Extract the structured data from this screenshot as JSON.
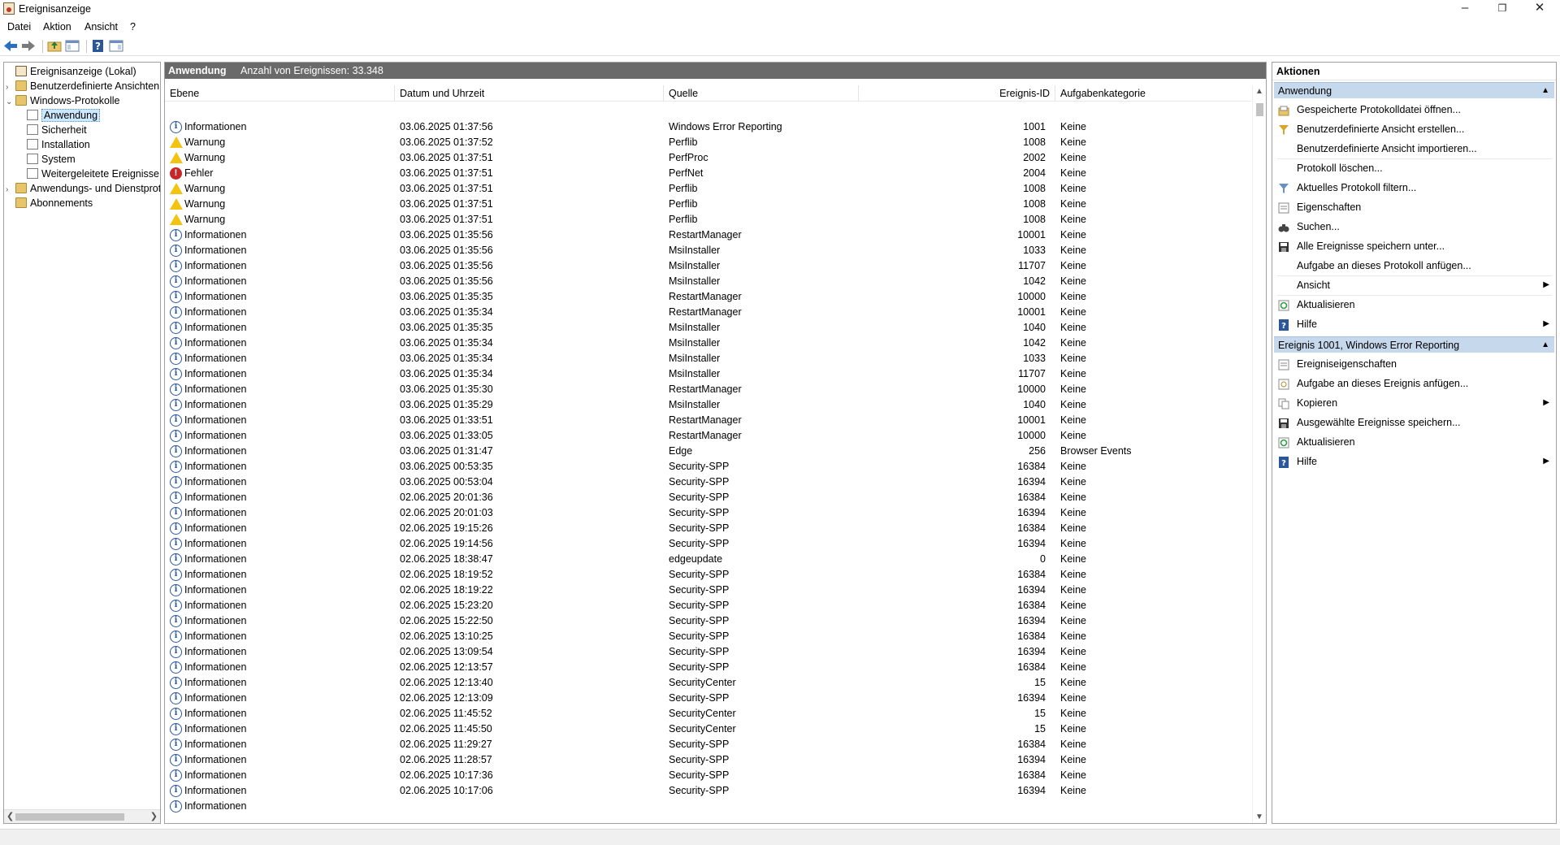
{
  "window": {
    "title": "Ereignisanzeige"
  },
  "menu": [
    "Datei",
    "Aktion",
    "Ansicht",
    "?"
  ],
  "tree": {
    "items": [
      {
        "label": "Ereignisanzeige (Lokal)",
        "level": 0,
        "icon": "root-icon",
        "expander": ""
      },
      {
        "label": "Benutzerdefinierte Ansichten",
        "level": 1,
        "icon": "folder-icon",
        "expander": "›"
      },
      {
        "label": "Windows-Protokolle",
        "level": 1,
        "icon": "folder-icon",
        "expander": "⌄"
      },
      {
        "label": "Anwendung",
        "level": 2,
        "icon": "log-icon",
        "expander": "",
        "selected": true
      },
      {
        "label": "Sicherheit",
        "level": 2,
        "icon": "log-icon",
        "expander": ""
      },
      {
        "label": "Installation",
        "level": 2,
        "icon": "log-icon",
        "expander": ""
      },
      {
        "label": "System",
        "level": 2,
        "icon": "log-icon",
        "expander": ""
      },
      {
        "label": "Weitergeleitete Ereignisse",
        "level": 2,
        "icon": "log-icon",
        "expander": ""
      },
      {
        "label": "Anwendungs- und Dienstprotokolle",
        "level": 1,
        "icon": "folder-icon",
        "expander": "›"
      },
      {
        "label": "Abonnements",
        "level": 1,
        "icon": "folder-icon",
        "expander": ""
      }
    ]
  },
  "center": {
    "log_name": "Anwendung",
    "count_text": "Anzahl von Ereignissen: 33.348",
    "columns": [
      "Ebene",
      "Datum und Uhrzeit",
      "Quelle",
      "Ereignis-ID",
      "Aufgabenkategorie"
    ],
    "rows": [
      {
        "level": "Informationen",
        "type": "info",
        "date": "03.06.2025 01:37:56",
        "source": "Windows Error Reporting",
        "id": "1001",
        "cat": "Keine"
      },
      {
        "level": "Warnung",
        "type": "warn",
        "date": "03.06.2025 01:37:52",
        "source": "Perflib",
        "id": "1008",
        "cat": "Keine"
      },
      {
        "level": "Warnung",
        "type": "warn",
        "date": "03.06.2025 01:37:51",
        "source": "PerfProc",
        "id": "2002",
        "cat": "Keine"
      },
      {
        "level": "Fehler",
        "type": "error",
        "date": "03.06.2025 01:37:51",
        "source": "PerfNet",
        "id": "2004",
        "cat": "Keine"
      },
      {
        "level": "Warnung",
        "type": "warn",
        "date": "03.06.2025 01:37:51",
        "source": "Perflib",
        "id": "1008",
        "cat": "Keine"
      },
      {
        "level": "Warnung",
        "type": "warn",
        "date": "03.06.2025 01:37:51",
        "source": "Perflib",
        "id": "1008",
        "cat": "Keine"
      },
      {
        "level": "Warnung",
        "type": "warn",
        "date": "03.06.2025 01:37:51",
        "source": "Perflib",
        "id": "1008",
        "cat": "Keine"
      },
      {
        "level": "Informationen",
        "type": "info",
        "date": "03.06.2025 01:35:56",
        "source": "RestartManager",
        "id": "10001",
        "cat": "Keine"
      },
      {
        "level": "Informationen",
        "type": "info",
        "date": "03.06.2025 01:35:56",
        "source": "MsiInstaller",
        "id": "1033",
        "cat": "Keine"
      },
      {
        "level": "Informationen",
        "type": "info",
        "date": "03.06.2025 01:35:56",
        "source": "MsiInstaller",
        "id": "11707",
        "cat": "Keine"
      },
      {
        "level": "Informationen",
        "type": "info",
        "date": "03.06.2025 01:35:56",
        "source": "MsiInstaller",
        "id": "1042",
        "cat": "Keine"
      },
      {
        "level": "Informationen",
        "type": "info",
        "date": "03.06.2025 01:35:35",
        "source": "RestartManager",
        "id": "10000",
        "cat": "Keine"
      },
      {
        "level": "Informationen",
        "type": "info",
        "date": "03.06.2025 01:35:34",
        "source": "RestartManager",
        "id": "10001",
        "cat": "Keine"
      },
      {
        "level": "Informationen",
        "type": "info",
        "date": "03.06.2025 01:35:35",
        "source": "MsiInstaller",
        "id": "1040",
        "cat": "Keine"
      },
      {
        "level": "Informationen",
        "type": "info",
        "date": "03.06.2025 01:35:34",
        "source": "MsiInstaller",
        "id": "1042",
        "cat": "Keine"
      },
      {
        "level": "Informationen",
        "type": "info",
        "date": "03.06.2025 01:35:34",
        "source": "MsiInstaller",
        "id": "1033",
        "cat": "Keine"
      },
      {
        "level": "Informationen",
        "type": "info",
        "date": "03.06.2025 01:35:34",
        "source": "MsiInstaller",
        "id": "11707",
        "cat": "Keine"
      },
      {
        "level": "Informationen",
        "type": "info",
        "date": "03.06.2025 01:35:30",
        "source": "RestartManager",
        "id": "10000",
        "cat": "Keine"
      },
      {
        "level": "Informationen",
        "type": "info",
        "date": "03.06.2025 01:35:29",
        "source": "MsiInstaller",
        "id": "1040",
        "cat": "Keine"
      },
      {
        "level": "Informationen",
        "type": "info",
        "date": "03.06.2025 01:33:51",
        "source": "RestartManager",
        "id": "10001",
        "cat": "Keine"
      },
      {
        "level": "Informationen",
        "type": "info",
        "date": "03.06.2025 01:33:05",
        "source": "RestartManager",
        "id": "10000",
        "cat": "Keine"
      },
      {
        "level": "Informationen",
        "type": "info",
        "date": "03.06.2025 01:31:47",
        "source": "Edge",
        "id": "256",
        "cat": "Browser Events"
      },
      {
        "level": "Informationen",
        "type": "info",
        "date": "03.06.2025 00:53:35",
        "source": "Security-SPP",
        "id": "16384",
        "cat": "Keine"
      },
      {
        "level": "Informationen",
        "type": "info",
        "date": "03.06.2025 00:53:04",
        "source": "Security-SPP",
        "id": "16394",
        "cat": "Keine"
      },
      {
        "level": "Informationen",
        "type": "info",
        "date": "02.06.2025 20:01:36",
        "source": "Security-SPP",
        "id": "16384",
        "cat": "Keine"
      },
      {
        "level": "Informationen",
        "type": "info",
        "date": "02.06.2025 20:01:03",
        "source": "Security-SPP",
        "id": "16394",
        "cat": "Keine"
      },
      {
        "level": "Informationen",
        "type": "info",
        "date": "02.06.2025 19:15:26",
        "source": "Security-SPP",
        "id": "16384",
        "cat": "Keine"
      },
      {
        "level": "Informationen",
        "type": "info",
        "date": "02.06.2025 19:14:56",
        "source": "Security-SPP",
        "id": "16394",
        "cat": "Keine"
      },
      {
        "level": "Informationen",
        "type": "info",
        "date": "02.06.2025 18:38:47",
        "source": "edgeupdate",
        "id": "0",
        "cat": "Keine"
      },
      {
        "level": "Informationen",
        "type": "info",
        "date": "02.06.2025 18:19:52",
        "source": "Security-SPP",
        "id": "16384",
        "cat": "Keine"
      },
      {
        "level": "Informationen",
        "type": "info",
        "date": "02.06.2025 18:19:22",
        "source": "Security-SPP",
        "id": "16394",
        "cat": "Keine"
      },
      {
        "level": "Informationen",
        "type": "info",
        "date": "02.06.2025 15:23:20",
        "source": "Security-SPP",
        "id": "16384",
        "cat": "Keine"
      },
      {
        "level": "Informationen",
        "type": "info",
        "date": "02.06.2025 15:22:50",
        "source": "Security-SPP",
        "id": "16394",
        "cat": "Keine"
      },
      {
        "level": "Informationen",
        "type": "info",
        "date": "02.06.2025 13:10:25",
        "source": "Security-SPP",
        "id": "16384",
        "cat": "Keine"
      },
      {
        "level": "Informationen",
        "type": "info",
        "date": "02.06.2025 13:09:54",
        "source": "Security-SPP",
        "id": "16394",
        "cat": "Keine"
      },
      {
        "level": "Informationen",
        "type": "info",
        "date": "02.06.2025 12:13:57",
        "source": "Security-SPP",
        "id": "16384",
        "cat": "Keine"
      },
      {
        "level": "Informationen",
        "type": "info",
        "date": "02.06.2025 12:13:40",
        "source": "SecurityCenter",
        "id": "15",
        "cat": "Keine"
      },
      {
        "level": "Informationen",
        "type": "info",
        "date": "02.06.2025 12:13:09",
        "source": "Security-SPP",
        "id": "16394",
        "cat": "Keine"
      },
      {
        "level": "Informationen",
        "type": "info",
        "date": "02.06.2025 11:45:52",
        "source": "SecurityCenter",
        "id": "15",
        "cat": "Keine"
      },
      {
        "level": "Informationen",
        "type": "info",
        "date": "02.06.2025 11:45:50",
        "source": "SecurityCenter",
        "id": "15",
        "cat": "Keine"
      },
      {
        "level": "Informationen",
        "type": "info",
        "date": "02.06.2025 11:29:27",
        "source": "Security-SPP",
        "id": "16384",
        "cat": "Keine"
      },
      {
        "level": "Informationen",
        "type": "info",
        "date": "02.06.2025 11:28:57",
        "source": "Security-SPP",
        "id": "16394",
        "cat": "Keine"
      },
      {
        "level": "Informationen",
        "type": "info",
        "date": "02.06.2025 10:17:36",
        "source": "Security-SPP",
        "id": "16384",
        "cat": "Keine"
      },
      {
        "level": "Informationen",
        "type": "info",
        "date": "02.06.2025 10:17:06",
        "source": "Security-SPP",
        "id": "16394",
        "cat": "Keine"
      },
      {
        "level": "Informationen",
        "type": "info",
        "date": "",
        "source": "",
        "id": "",
        "cat": ""
      }
    ]
  },
  "actions": {
    "title": "Aktionen",
    "sections": [
      {
        "title": "Anwendung",
        "items": [
          {
            "label": "Gespeicherte Protokolldatei öffnen...",
            "icon": "open-log-icon"
          },
          {
            "label": "Benutzerdefinierte Ansicht erstellen...",
            "icon": "filter-create-icon"
          },
          {
            "label": "Benutzerdefinierte Ansicht importieren...",
            "icon": ""
          },
          {
            "label": "Protokoll löschen...",
            "icon": "",
            "sep": true
          },
          {
            "label": "Aktuelles Protokoll filtern...",
            "icon": "filter-icon"
          },
          {
            "label": "Eigenschaften",
            "icon": "properties-icon"
          },
          {
            "label": "Suchen...",
            "icon": "binoculars-icon"
          },
          {
            "label": "Alle Ereignisse speichern unter...",
            "icon": "save-icon"
          },
          {
            "label": "Aufgabe an dieses Protokoll anfügen...",
            "icon": ""
          },
          {
            "label": "Ansicht",
            "icon": "",
            "submenu": true,
            "sep": true
          },
          {
            "label": "Aktualisieren",
            "icon": "refresh-icon",
            "sep": true
          },
          {
            "label": "Hilfe",
            "icon": "help-icon",
            "submenu": true
          }
        ]
      },
      {
        "title": "Ereignis 1001, Windows Error Reporting",
        "items": [
          {
            "label": "Ereigniseigenschaften",
            "icon": "event-properties-icon"
          },
          {
            "label": "Aufgabe an dieses Ereignis anfügen...",
            "icon": "task-icon"
          },
          {
            "label": "Kopieren",
            "icon": "copy-icon",
            "submenu": true
          },
          {
            "label": "Ausgewählte Ereignisse speichern...",
            "icon": "save-icon"
          },
          {
            "label": "Aktualisieren",
            "icon": "refresh-icon"
          },
          {
            "label": "Hilfe",
            "icon": "help-icon",
            "submenu": true
          }
        ]
      }
    ]
  }
}
